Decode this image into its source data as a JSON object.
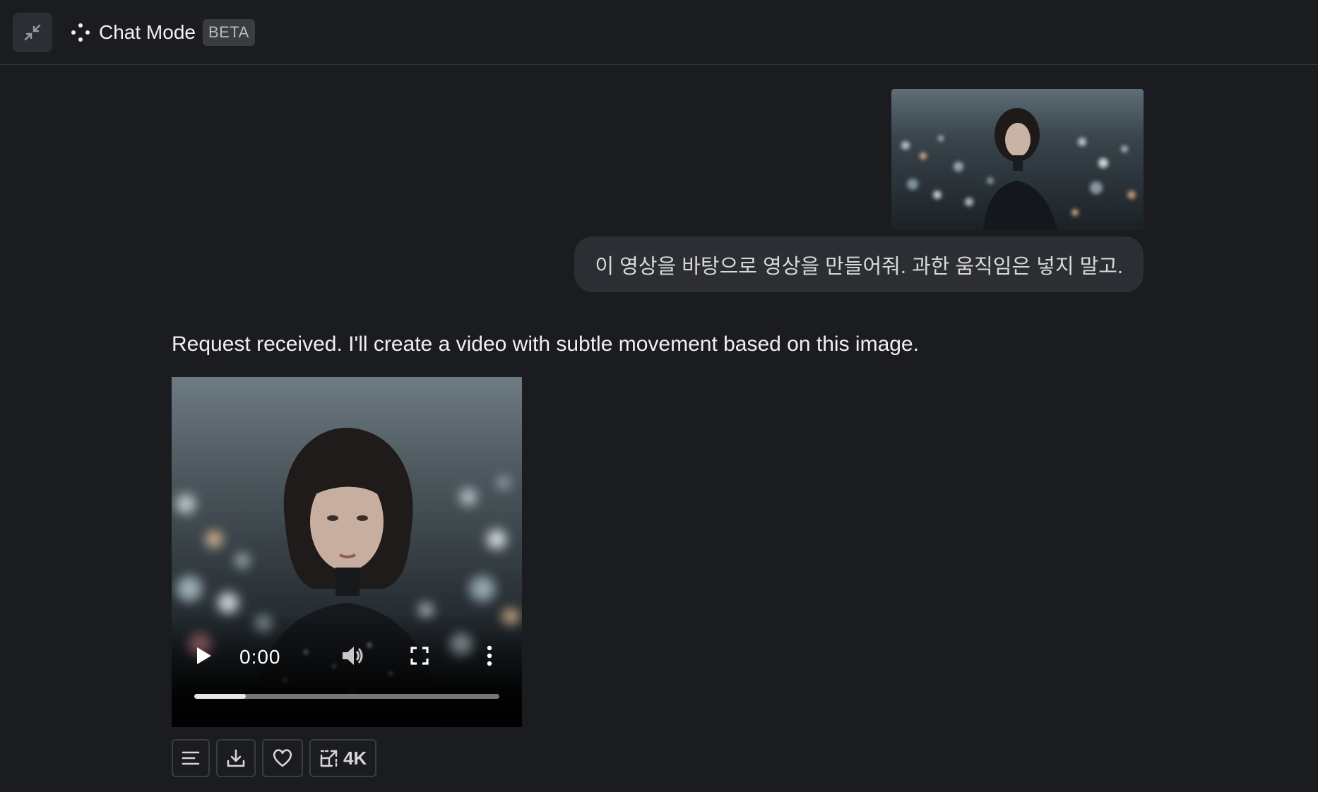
{
  "header": {
    "title": "Chat Mode",
    "badge": "BETA",
    "collapse_icon": "collapse-arrows-icon",
    "mode_icon": "sparkle-dots-icon"
  },
  "conversation": {
    "user_message": {
      "attachment_alt": "attached image",
      "text": "이 영상을 바탕으로 영상을 만들어줘. 과한 움직임은 넣지 말고."
    },
    "assistant_message": {
      "text": "Request received. I'll create a video with subtle movement based on this image.",
      "video": {
        "current_time": "0:00",
        "progress": 0.17,
        "play_icon": "play-icon",
        "volume_icon": "volume-icon",
        "fullscreen_icon": "fullscreen-icon",
        "more_icon": "more-vertical-icon"
      },
      "actions": [
        {
          "icon": "text-lines-icon",
          "label": ""
        },
        {
          "icon": "download-icon",
          "label": ""
        },
        {
          "icon": "heart-icon",
          "label": ""
        },
        {
          "icon": "upscale-icon",
          "label": "4K"
        }
      ]
    }
  },
  "colors": {
    "background": "#1b1c1f",
    "bubble": "#2c2e33",
    "border": "#3a3c42"
  }
}
